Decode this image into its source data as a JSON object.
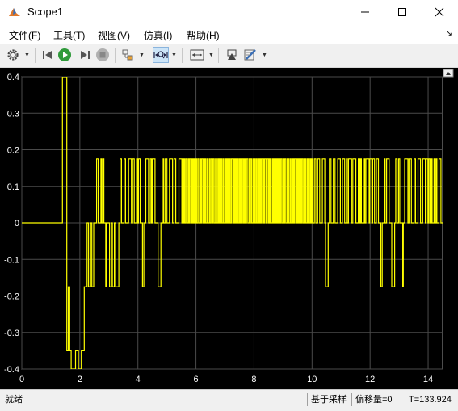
{
  "window": {
    "title": "Scope1",
    "icon": "matlab-scope-icon",
    "buttons": [
      "minimize-icon",
      "maximize-icon",
      "close-icon"
    ]
  },
  "menu": {
    "file": "文件(F)",
    "tools": "工具(T)",
    "view": "视图(V)",
    "simulation": "仿真(I)",
    "help": "帮助(H)"
  },
  "toolbar": {
    "icons": [
      "gear-icon",
      "step-back-icon",
      "run-icon",
      "stop-icon",
      "highlight-block-icon",
      "zoom-time-icon",
      "autoscale-icon",
      "restore-icon",
      "style-icon"
    ]
  },
  "colors": {
    "plot_background": "#000000",
    "grid": "#4a4a4a",
    "axis_labels": "#ffffff",
    "signal": "#ffff00"
  },
  "chart_data": {
    "type": "line",
    "title": "",
    "xlabel": "",
    "ylabel": "",
    "xlim": [
      0,
      14.5
    ],
    "ylim": [
      -0.4,
      0.4
    ],
    "x_ticks": [
      "0",
      "2",
      "4",
      "6",
      "8",
      "10",
      "12",
      "14"
    ],
    "y_ticks": [
      "0.4",
      "0.3",
      "0.2",
      "0.1",
      "0",
      "-0.1",
      "-0.2",
      "-0.3",
      "-0.4"
    ],
    "grid": true,
    "series": [
      {
        "color": "#ffff00",
        "levels": [
          0.175,
          0,
          -0.175,
          -0.35,
          0.4,
          -0.4
        ],
        "dense_switching_interval": [
          2.3,
          14.5
        ],
        "x": [
          0,
          1.4,
          1.4,
          1.55,
          1.55,
          1.6,
          1.6,
          1.65,
          1.65,
          1.7,
          1.7,
          1.85,
          1.85,
          1.95,
          1.95,
          2.05,
          2.05,
          2.15,
          2.15,
          2.25,
          2.25,
          2.3
        ],
        "y": [
          0,
          0,
          0.4,
          0.4,
          -0.35,
          -0.35,
          -0.175,
          -0.175,
          -0.35,
          -0.35,
          -0.4,
          -0.4,
          -0.35,
          -0.35,
          -0.4,
          -0.4,
          -0.35,
          -0.35,
          -0.175,
          -0.175,
          0,
          0
        ]
      }
    ]
  },
  "status": {
    "left": "就绪",
    "mode": "基于采样",
    "offset": "偏移量=0",
    "time": "T=133.924"
  }
}
